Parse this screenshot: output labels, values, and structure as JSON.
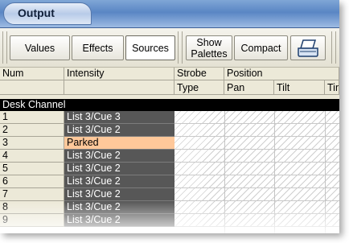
{
  "window": {
    "title": "Output"
  },
  "toolbar": {
    "values_label": "Values",
    "effects_label": "Effects",
    "sources_label": "Sources",
    "show_palettes_line1": "Show",
    "show_palettes_line2": "Palettes",
    "compact_label": "Compact",
    "print_icon": "print-icon"
  },
  "grid": {
    "headers_top": {
      "num": "Num",
      "intensity": "Intensity",
      "strobe": "Strobe",
      "position": "Position"
    },
    "headers_sub": {
      "type": "Type",
      "pan": "Pan",
      "tilt": "Tilt",
      "time": "Tim"
    },
    "group_label": "Desk Channel",
    "rows": [
      {
        "num": "1",
        "intensity": "List 3/Cue 3"
      },
      {
        "num": "2",
        "intensity": "List 3/Cue 2"
      },
      {
        "num": "3",
        "intensity": "Parked"
      },
      {
        "num": "4",
        "intensity": "List 3/Cue 2"
      },
      {
        "num": "5",
        "intensity": "List 3/Cue 2"
      },
      {
        "num": "6",
        "intensity": "List 3/Cue 2"
      },
      {
        "num": "7",
        "intensity": "List 3/Cue 2"
      },
      {
        "num": "8",
        "intensity": "List 3/Cue 2"
      },
      {
        "num": "9",
        "intensity": "List 3/Cue 2"
      }
    ],
    "colors": {
      "intensity_bg": "#575757",
      "parked_bg": "#ffc89a",
      "group_bg": "#000000"
    }
  }
}
